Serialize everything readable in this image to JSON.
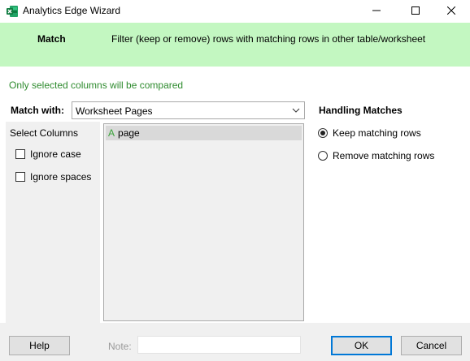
{
  "window": {
    "title": "Analytics Edge Wizard",
    "app_icon": "excel-icon",
    "controls": [
      "minimize-icon",
      "maximize-icon",
      "close-icon"
    ]
  },
  "header": {
    "step_name": "Match",
    "step_description": "Filter (keep or remove) rows with matching rows in other table/worksheet",
    "background": "#c3f7c1"
  },
  "hint": {
    "text": "Only selected columns will be compared",
    "color": "#2e8b2e"
  },
  "match_with": {
    "label": "Match with:",
    "selected": "Worksheet Pages"
  },
  "select_columns": {
    "label": "Select Columns",
    "options": [
      {
        "label": "Ignore case",
        "checked": false
      },
      {
        "label": "Ignore spaces",
        "checked": false
      }
    ],
    "columns": [
      {
        "type_marker": "A",
        "name": "page",
        "selected": true
      }
    ]
  },
  "handling": {
    "title": "Handling Matches",
    "options": [
      {
        "label": "Keep matching rows",
        "checked": true
      },
      {
        "label": "Remove matching rows",
        "checked": false
      }
    ]
  },
  "footer": {
    "help_label": "Help",
    "note_label": "Note:",
    "note_value": "",
    "ok_label": "OK",
    "cancel_label": "Cancel"
  }
}
